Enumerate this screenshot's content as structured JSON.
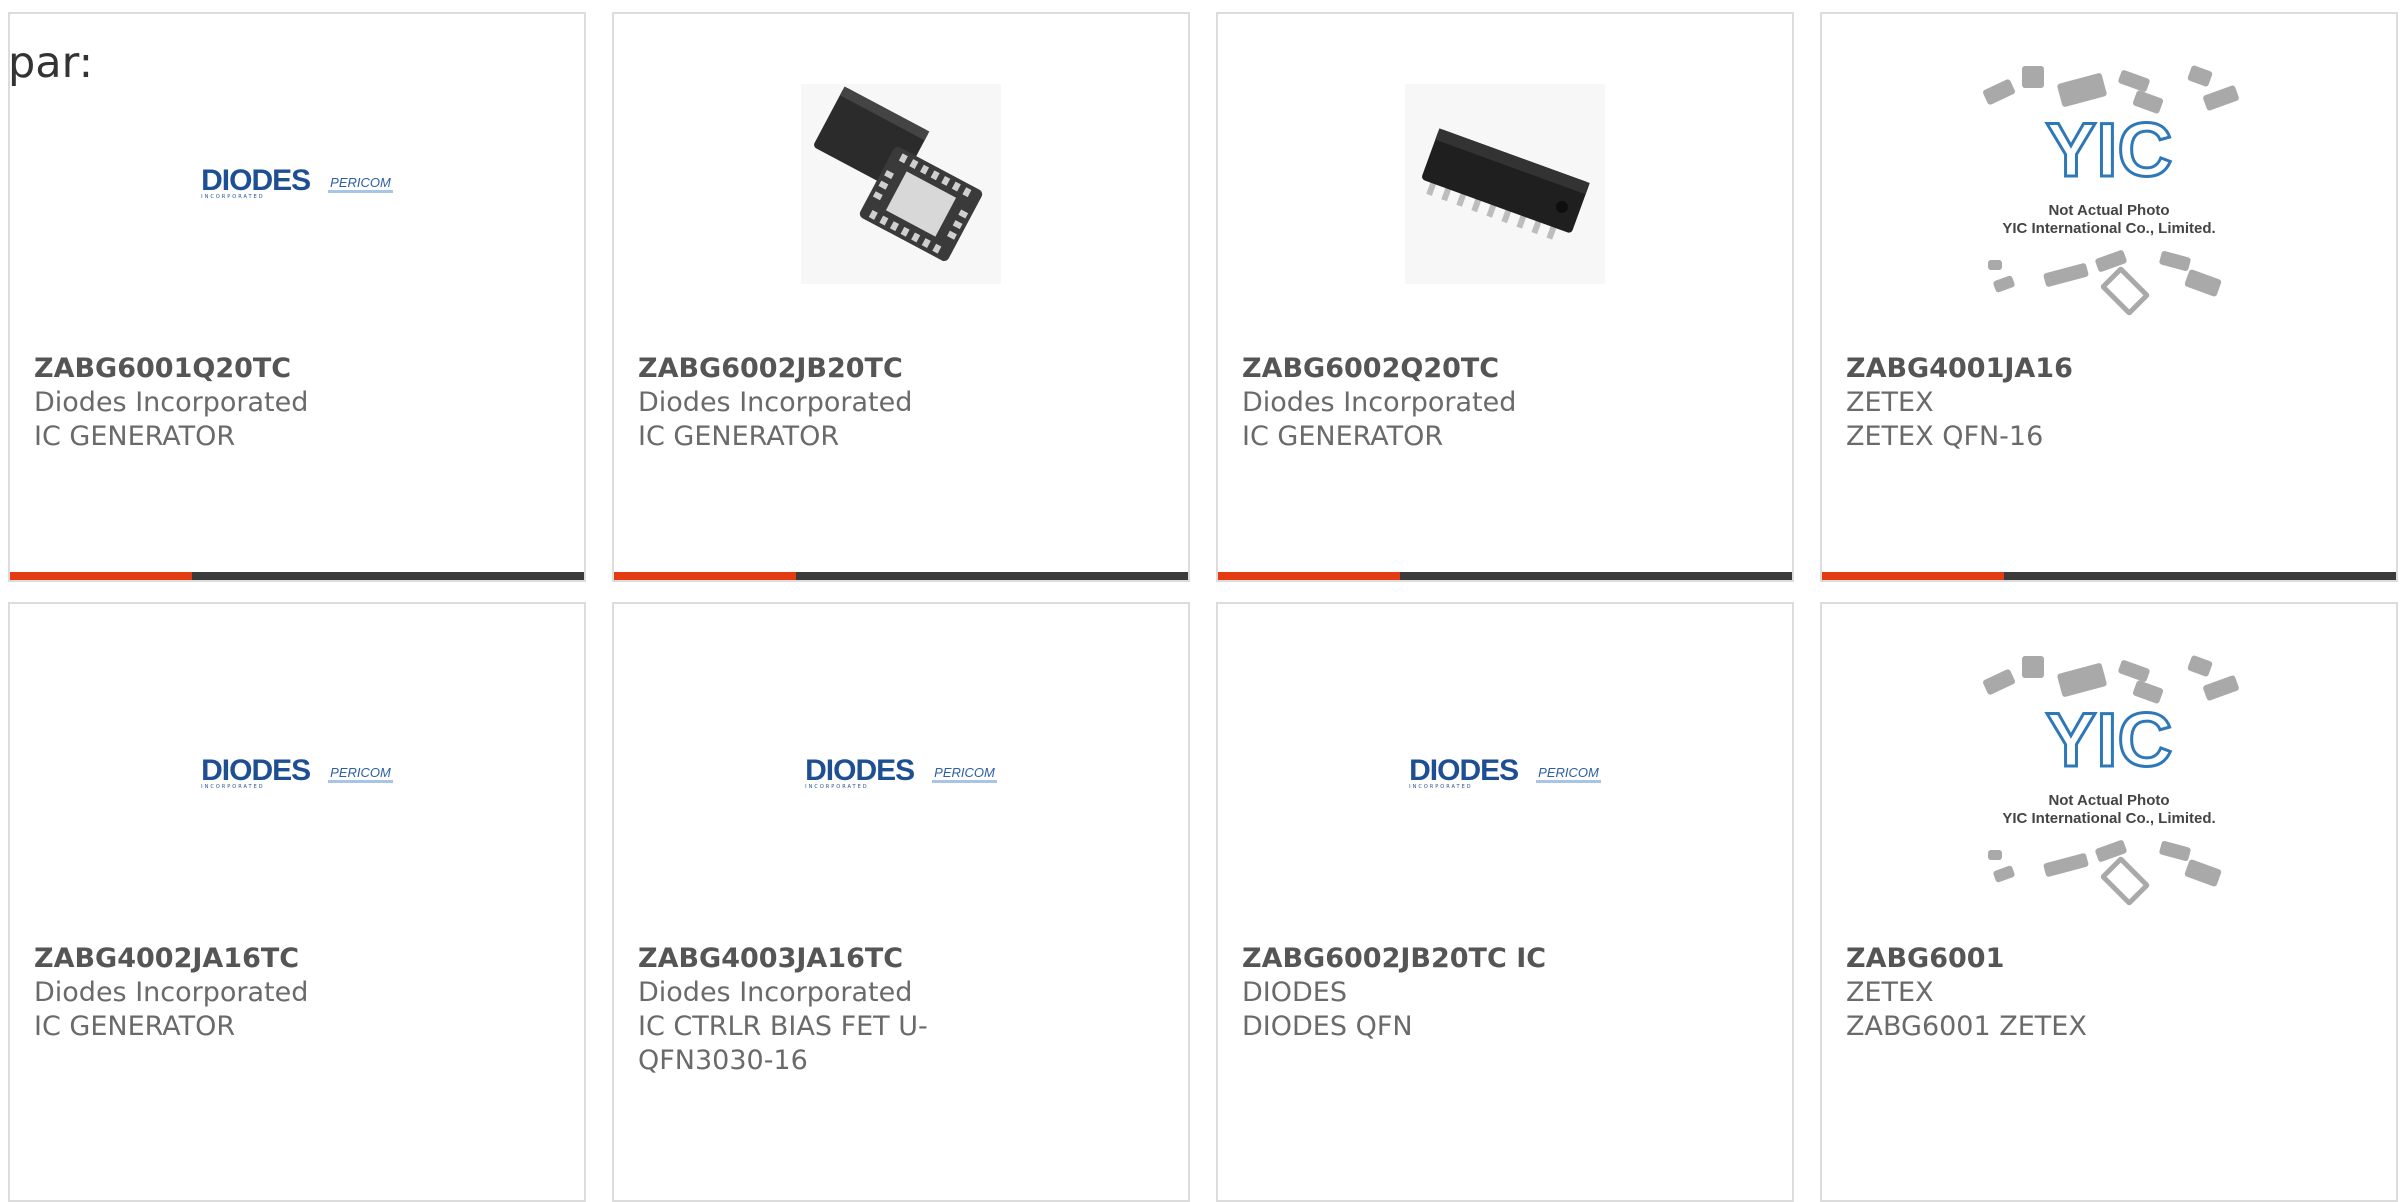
{
  "page": {
    "prefix": "par:"
  },
  "logos": {
    "diodes_word": "DIODES",
    "diodes_sub": "INCORPORATED",
    "pericom": "PERICOM",
    "yic_big": "YIC",
    "yic_line1": "Not Actual Photo",
    "yic_line2": "YIC International Co., Limited."
  },
  "colors": {
    "accent": "#e43b12",
    "bar": "#3b3b3b",
    "border": "#dcdcdc",
    "diodes_blue": "#1e4f93"
  },
  "products": [
    {
      "part": "ZABG6001Q20TC",
      "maker": "Diodes Incorporated",
      "desc": "IC GENERATOR",
      "image": "diodes-logo"
    },
    {
      "part": "ZABG6002JB20TC",
      "maker": "Diodes Incorporated",
      "desc": "IC GENERATOR",
      "image": "qfn-chip-photo"
    },
    {
      "part": "ZABG6002Q20TC",
      "maker": "Diodes Incorporated",
      "desc": "IC GENERATOR",
      "image": "soic-chip-photo"
    },
    {
      "part": "ZABG4001JA16",
      "maker": "ZETEX",
      "desc": "ZETEX QFN-16",
      "image": "yic-not-actual-photo"
    },
    {
      "part": "ZABG4002JA16TC",
      "maker": "Diodes Incorporated",
      "desc": "IC GENERATOR",
      "image": "diodes-logo"
    },
    {
      "part": "ZABG4003JA16TC",
      "maker": "Diodes Incorporated",
      "desc": "IC CTRLR BIAS FET U-QFN3030-16",
      "image": "diodes-logo"
    },
    {
      "part": "ZABG6002JB20TC IC",
      "maker": "DIODES",
      "desc": "DIODES QFN",
      "image": "diodes-logo"
    },
    {
      "part": "ZABG6001",
      "maker": "ZETEX",
      "desc": "ZABG6001 ZETEX",
      "image": "yic-not-actual-photo"
    }
  ]
}
